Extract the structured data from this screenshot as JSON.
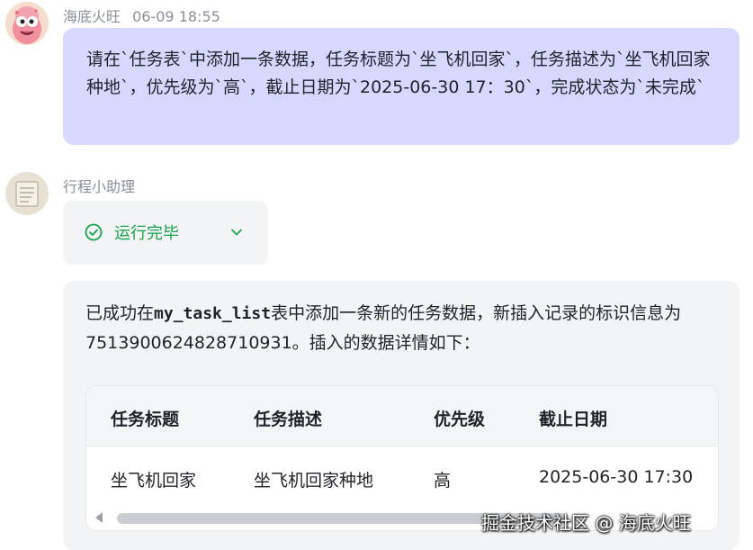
{
  "user_message": {
    "sender": "海底火旺",
    "time": "06-09 18:55",
    "text": "请在`任务表`中添加一条数据，任务标题为`坐飞机回家`，任务描述为`坐飞机回家种地`，优先级为`高`，截止日期为`2025-06-30 17：30`，完成状态为`未完成`"
  },
  "bot_message": {
    "sender": "行程小助理",
    "status": {
      "icon": "check-circle-icon",
      "label": "运行完毕",
      "color": "#19a34a"
    },
    "reply": {
      "prefix": "已成功在",
      "table_name": "my_task_list",
      "suffix": "表中添加一条新的任务数据，新插入记录的标识信息为 7513900624828710931。插入的数据详情如下："
    },
    "table": {
      "headers": [
        "任务标题",
        "任务描述",
        "优先级",
        "截止日期"
      ],
      "rows": [
        [
          "坐飞机回家",
          "坐飞机回家种地",
          "高",
          "2025-06-30 17:30"
        ]
      ]
    }
  },
  "watermark": "掘金技术社区 @ 海底火旺",
  "colors": {
    "user_bubble": "#d7d8ff",
    "bot_bubble": "#f3f4f6",
    "success": "#19a34a"
  }
}
